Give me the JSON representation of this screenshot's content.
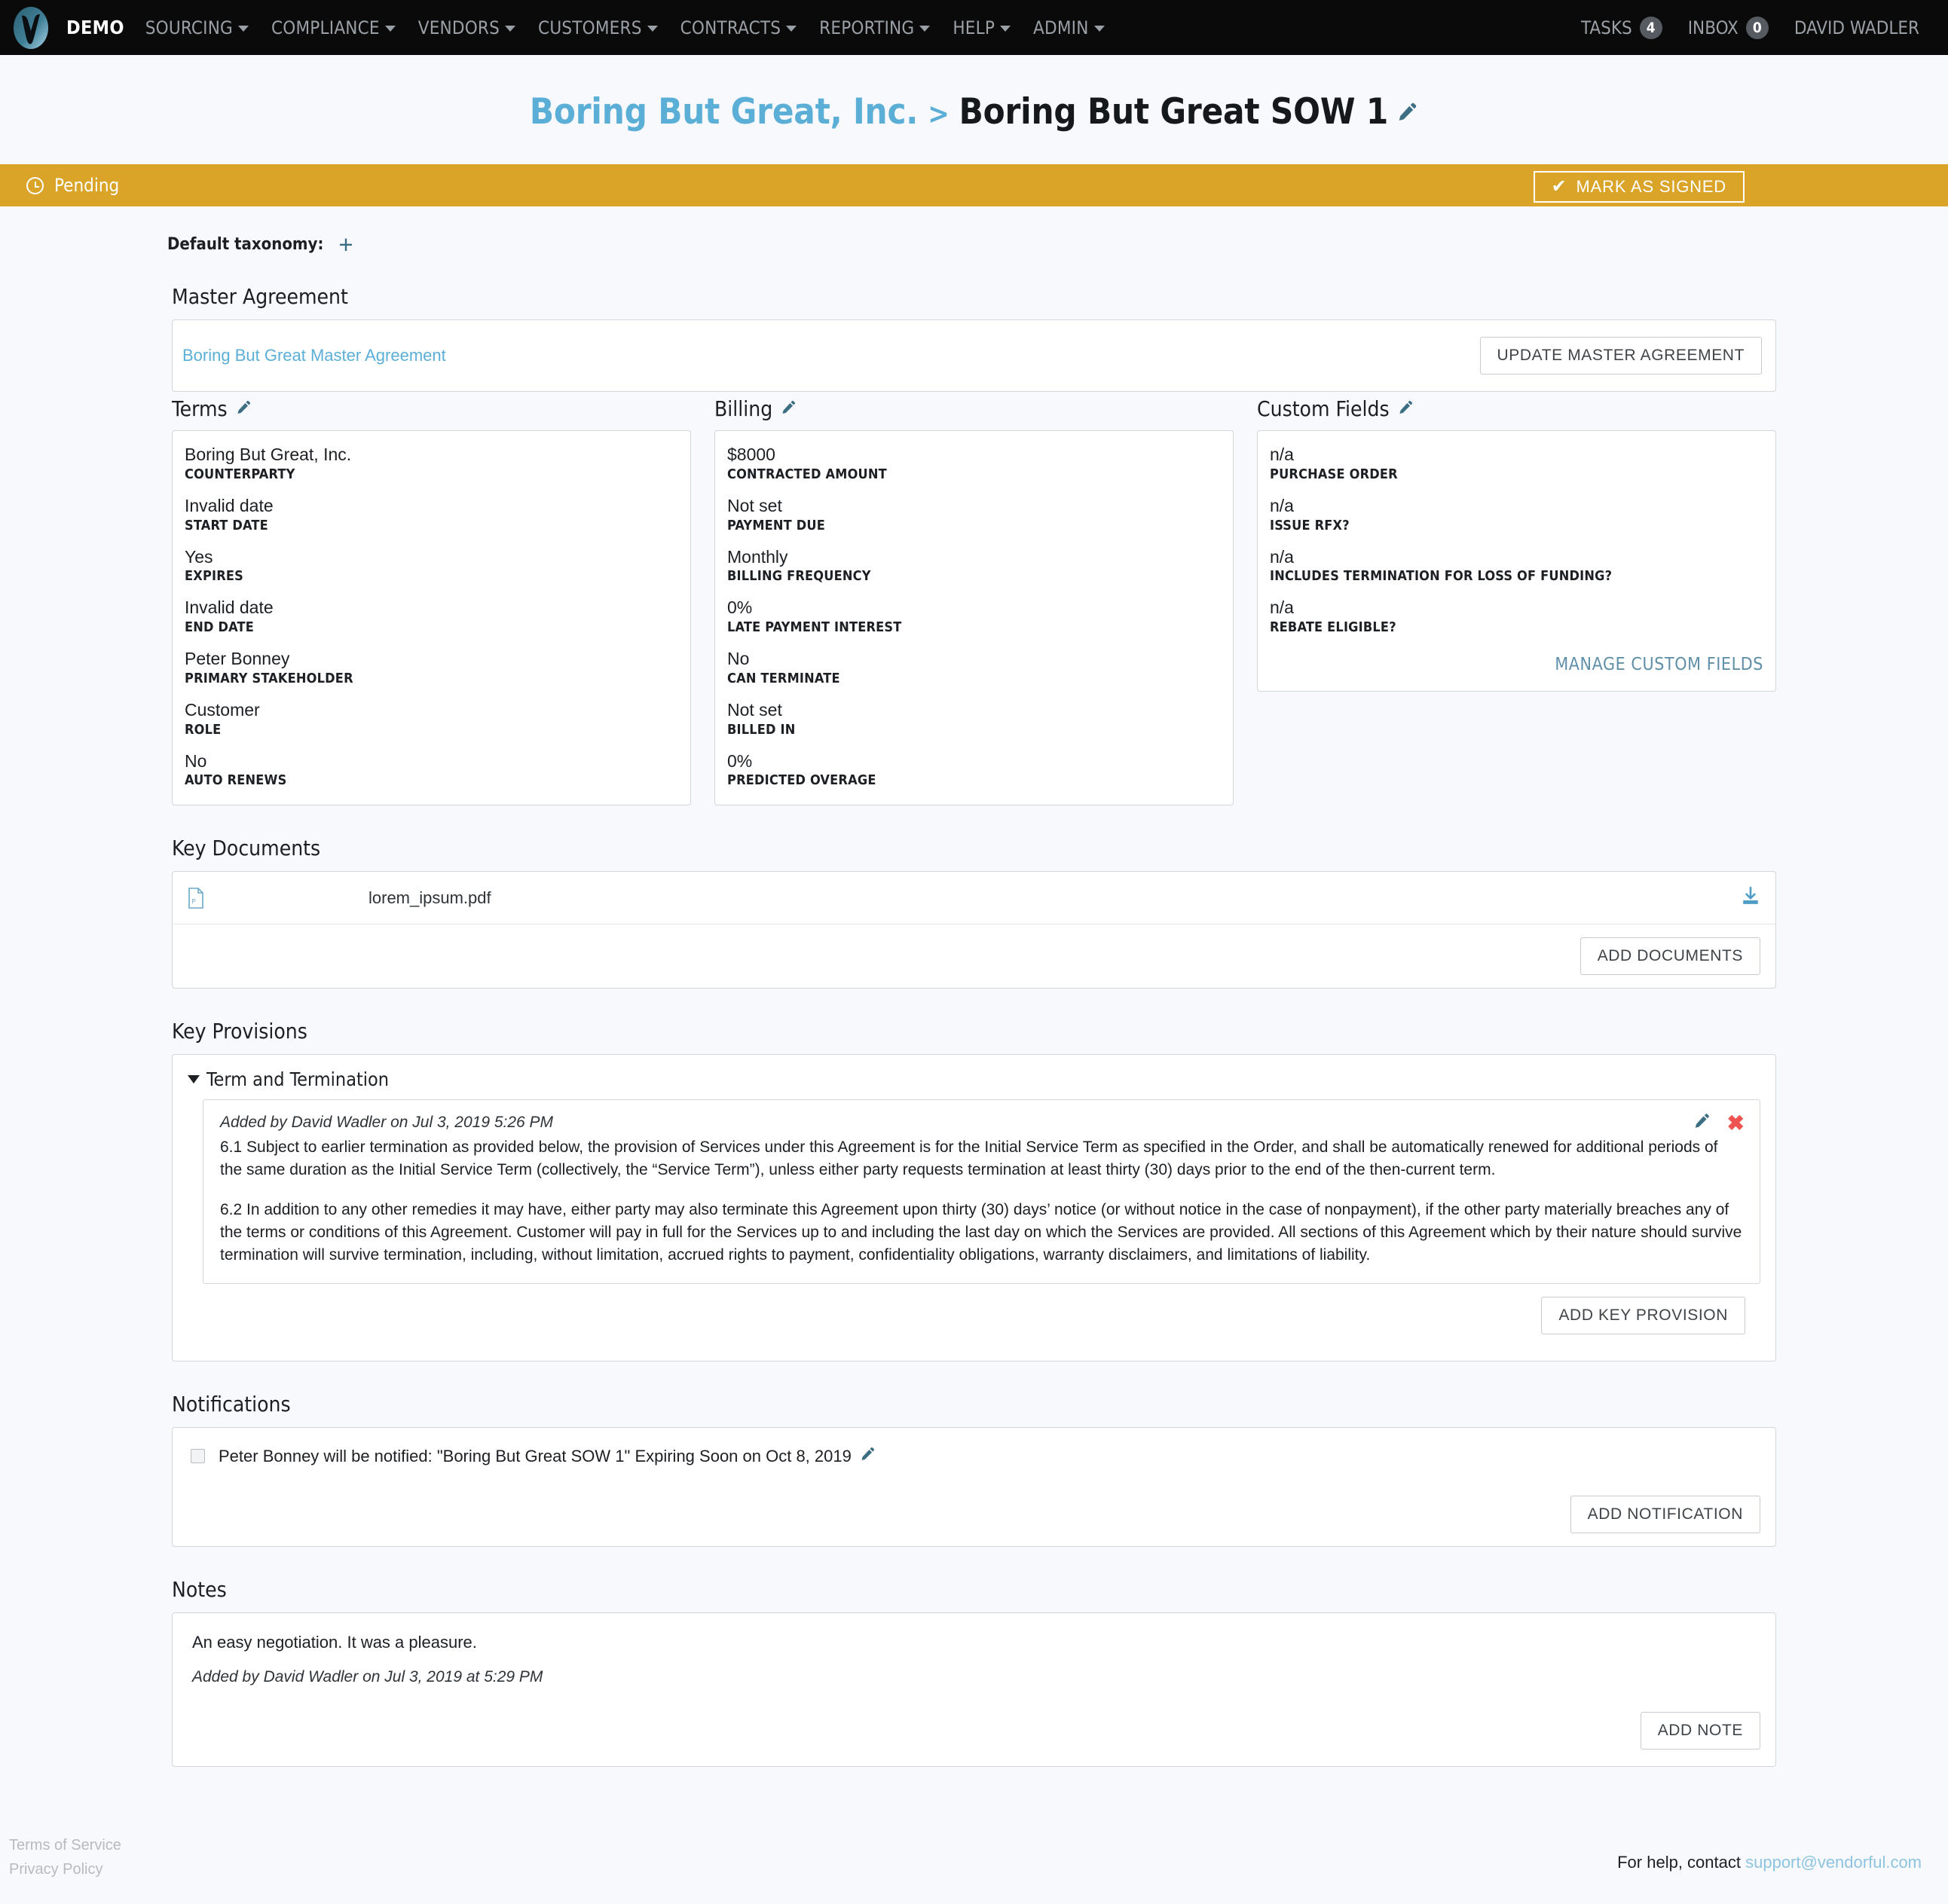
{
  "navbar": {
    "brand": "DEMO",
    "logo_icon": "vendorful-v-logo",
    "items": [
      {
        "label": "SOURCING",
        "caret": true
      },
      {
        "label": "COMPLIANCE",
        "caret": true
      },
      {
        "label": "VENDORS",
        "caret": true
      },
      {
        "label": "CUSTOMERS",
        "caret": true
      },
      {
        "label": "CONTRACTS",
        "caret": true
      },
      {
        "label": "REPORTING",
        "caret": true
      },
      {
        "label": "HELP",
        "caret": true
      },
      {
        "label": "ADMIN",
        "caret": true
      }
    ],
    "right": {
      "tasks_label": "TASKS",
      "tasks_count": "4",
      "inbox_label": "INBOX",
      "inbox_count": "0",
      "user_label": "DAVID WADLER"
    }
  },
  "header": {
    "breadcrumb_parent": "Boring But Great, Inc.",
    "breadcrumb_separator": ">",
    "title": "Boring But Great SOW 1",
    "edit_icon": "pencil-icon"
  },
  "status": {
    "icon": "clock-icon",
    "text": "Pending",
    "action_label": "MARK AS SIGNED",
    "action_icon": "check-icon",
    "bar_color": "#d9a428"
  },
  "taxonomy": {
    "label": "Default taxonomy:",
    "add_icon": "plus-icon"
  },
  "master_agreement": {
    "section_title": "Master Agreement",
    "link_label": "Boring But Great Master Agreement",
    "button_label": "UPDATE MASTER AGREEMENT"
  },
  "terms": {
    "title": "Terms",
    "edit_icon": "pencil-icon",
    "fields": [
      {
        "value": "Boring But Great, Inc.",
        "label": "COUNTERPARTY"
      },
      {
        "value": "Invalid date",
        "label": "START DATE"
      },
      {
        "value": "Yes",
        "label": "EXPIRES"
      },
      {
        "value": "Invalid date",
        "label": "END DATE"
      },
      {
        "value": "Peter Bonney",
        "label": "PRIMARY STAKEHOLDER"
      },
      {
        "value": "Customer",
        "label": "ROLE"
      },
      {
        "value": "No",
        "label": "AUTO RENEWS"
      }
    ]
  },
  "billing": {
    "title": "Billing",
    "edit_icon": "pencil-icon",
    "fields": [
      {
        "value": "$8000",
        "label": "CONTRACTED AMOUNT"
      },
      {
        "value": "Not set",
        "label": "PAYMENT DUE"
      },
      {
        "value": "Monthly",
        "label": "BILLING FREQUENCY"
      },
      {
        "value": "0%",
        "label": "LATE PAYMENT INTEREST"
      },
      {
        "value": "No",
        "label": "CAN TERMINATE"
      },
      {
        "value": "Not set",
        "label": "BILLED IN"
      },
      {
        "value": "0%",
        "label": "PREDICTED OVERAGE"
      }
    ]
  },
  "custom_fields": {
    "title": "Custom Fields",
    "edit_icon": "pencil-icon",
    "fields": [
      {
        "value": "n/a",
        "label": "PURCHASE ORDER"
      },
      {
        "value": "n/a",
        "label": "ISSUE RFX?"
      },
      {
        "value": "n/a",
        "label": "INCLUDES TERMINATION FOR LOSS OF FUNDING?"
      },
      {
        "value": "n/a",
        "label": "REBATE ELIGIBLE?"
      }
    ],
    "manage_link": "MANAGE CUSTOM FIELDS"
  },
  "key_documents": {
    "section_title": "Key Documents",
    "rows": [
      {
        "file_icon": "pdf-file-icon",
        "name": "lorem_ipsum.pdf",
        "download_icon": "download-icon"
      }
    ],
    "button_label": "ADD DOCUMENTS"
  },
  "key_provisions": {
    "section_title": "Key Provisions",
    "group_title": "Term and Termination",
    "entry": {
      "meta": "Added by David Wadler on Jul 3, 2019 5:26 PM",
      "edit_icon": "pencil-icon",
      "delete_icon": "close-x-icon",
      "paragraphs": [
        "6.1 Subject to earlier termination as provided below, the provision of Services under this Agreement is for the Initial Service Term as specified in the Order, and shall be automatically renewed for additional periods of the same duration as the Initial Service Term (collectively, the “Service Term”), unless either party requests termination at least thirty (30) days prior to the end of the then-current term.",
        "6.2 In addition to any other remedies it may have, either party may also terminate this Agreement upon thirty (30) days’ notice (or without notice in the case of nonpayment), if the other party materially breaches any of the terms or conditions of this Agreement. Customer will pay in full for the Services up to and including the last day on which the Services are provided. All sections of this Agreement which by their nature should survive termination will survive termination, including, without limitation, accrued rights to payment, confidentiality obligations, warranty disclaimers, and limitations of liability."
      ]
    },
    "button_label": "ADD KEY PROVISION"
  },
  "notifications": {
    "section_title": "Notifications",
    "rows": [
      {
        "checked": false,
        "text": "Peter Bonney will be notified: \"Boring But Great SOW 1\" Expiring Soon on Oct 8, 2019",
        "edit_icon": "pencil-icon"
      }
    ],
    "button_label": "ADD NOTIFICATION"
  },
  "notes": {
    "section_title": "Notes",
    "rows": [
      {
        "text": "An easy negotiation. It was a pleasure.",
        "meta": "Added by David Wadler on Jul 3, 2019 at 5:29 PM"
      }
    ],
    "button_label": "ADD NOTE"
  },
  "footer": {
    "terms_label": "Terms of Service",
    "privacy_label": "Privacy Policy",
    "help_prefix": "For help, contact",
    "help_email": "support@vendorful.com"
  }
}
